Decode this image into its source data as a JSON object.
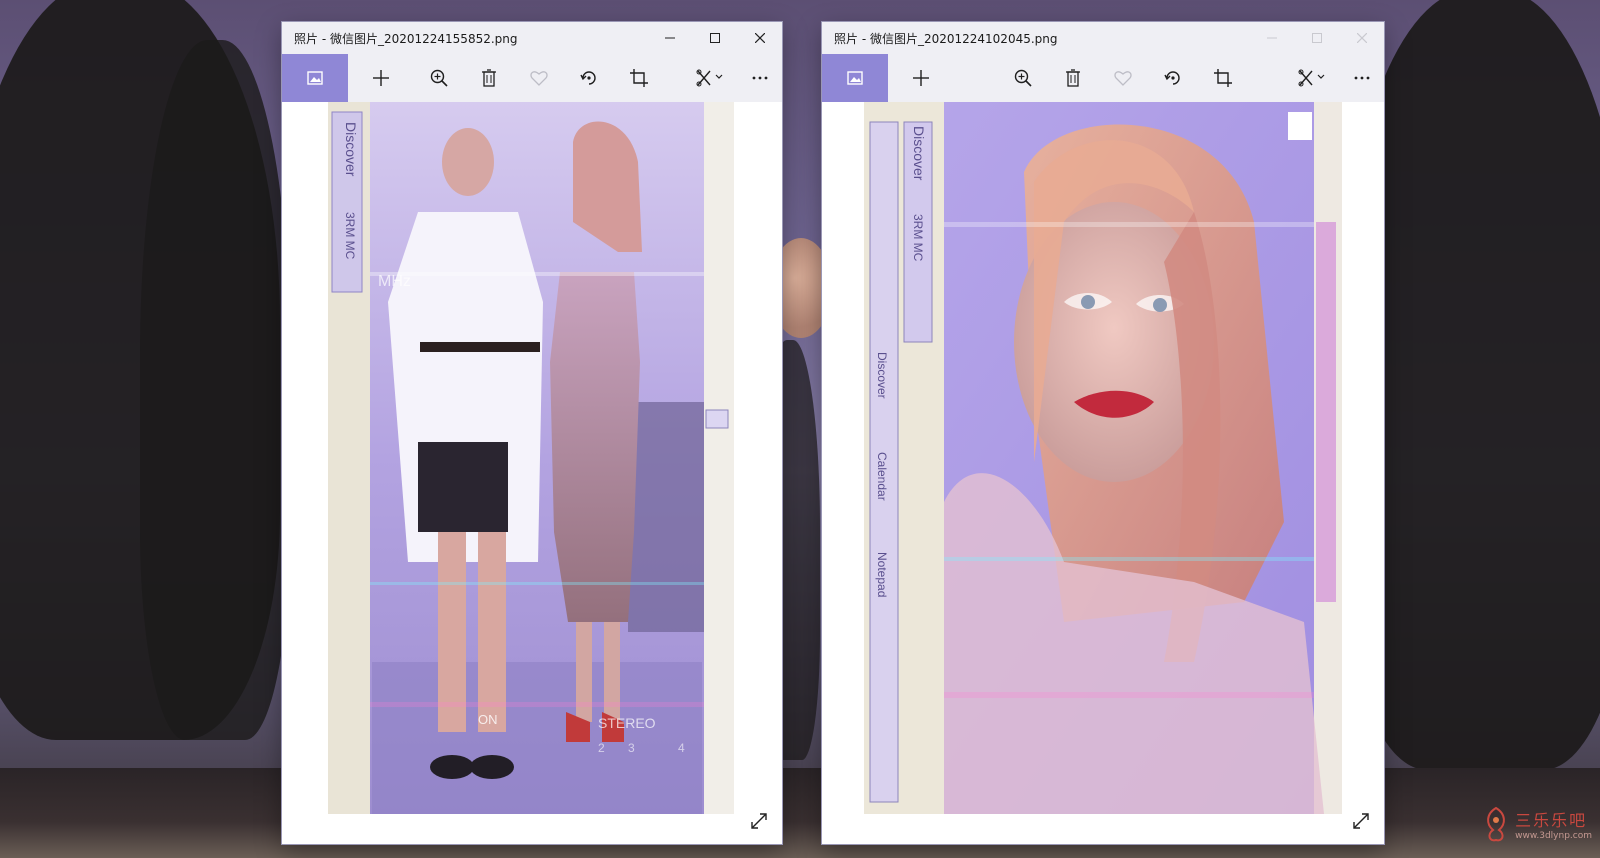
{
  "desktop": {
    "watermark": {
      "text": "三乐乐吧",
      "subtitle": "www.3dlynp.com"
    }
  },
  "windows": [
    {
      "title": "照片 - 微信图片_20201224155852.png",
      "active": true,
      "toolbar": {
        "home_icon": "image-icon",
        "buttons": [
          {
            "name": "add-icon"
          },
          {
            "name": "zoom-in-icon"
          },
          {
            "name": "delete-icon"
          },
          {
            "name": "favorite-icon"
          },
          {
            "name": "rotate-icon"
          },
          {
            "name": "crop-icon"
          },
          {
            "name": "edit-create-icon"
          },
          {
            "name": "more-icon"
          }
        ]
      },
      "photo": {
        "texts": [
          "Discover",
          "3RM MC",
          "MHz",
          "STEREO",
          "ON",
          "2",
          "3",
          "4"
        ]
      },
      "expand_icon": "fullscreen-icon"
    },
    {
      "title": "照片 - 微信图片_20201224102045.png",
      "active": false,
      "toolbar": {
        "home_icon": "image-icon",
        "buttons": [
          {
            "name": "add-icon"
          },
          {
            "name": "zoom-in-icon"
          },
          {
            "name": "delete-icon"
          },
          {
            "name": "favorite-icon"
          },
          {
            "name": "rotate-icon"
          },
          {
            "name": "crop-icon"
          },
          {
            "name": "edit-create-icon"
          },
          {
            "name": "more-icon"
          }
        ]
      },
      "photo": {
        "texts": [
          "Discover",
          "3RM MC",
          "Discover",
          "Calendar",
          "Notepad"
        ]
      },
      "expand_icon": "fullscreen-icon"
    }
  ],
  "colors": {
    "accent": "#8f87d6",
    "titlebar": "#efeff4",
    "photo_tint": "#b8a6e6"
  }
}
